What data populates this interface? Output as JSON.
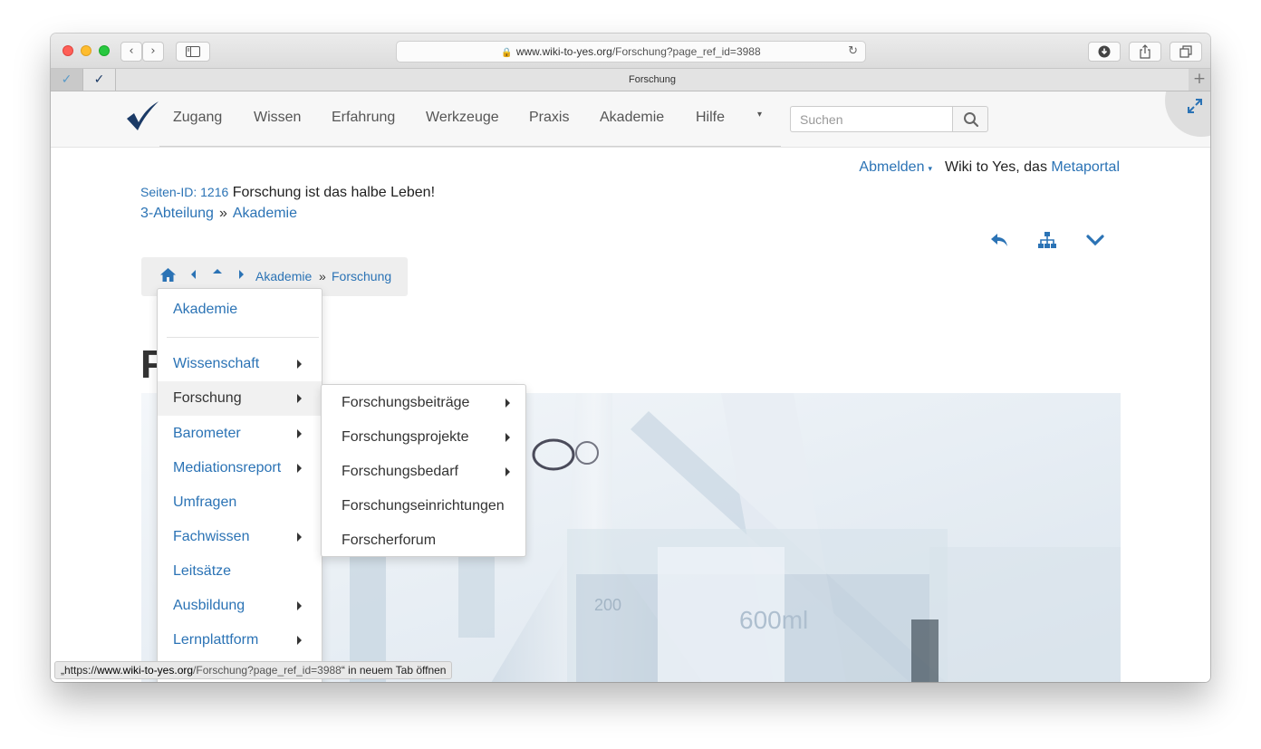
{
  "browser": {
    "url_host": "www.wiki-to-yes.org",
    "url_path": "/Forschung?page_ref_id=3988",
    "tab_title": "Forschung",
    "new_tab_label": "+",
    "back_icon": "‹",
    "forward_icon": "›"
  },
  "navbar": {
    "items": [
      "Zugang",
      "Wissen",
      "Erfahrung",
      "Werkzeuge",
      "Praxis",
      "Akademie",
      "Hilfe"
    ],
    "search_placeholder": "Suchen",
    "more_icon": "▾"
  },
  "user": {
    "logout_label": "Abmelden",
    "tagline": "Wiki to Yes, das",
    "portal_link": "Metaportal"
  },
  "page": {
    "id_label": "Seiten-ID: 1216",
    "title": "Forschung ist das halbe Leben!",
    "heading_letter": "F"
  },
  "crumbs": {
    "items": [
      "3-Abteilung",
      "Akademie"
    ],
    "separator": "»"
  },
  "breadcrumb_nav": {
    "items": [
      "Akademie",
      "Forschung"
    ],
    "separator": "»"
  },
  "menu": {
    "header": "Akademie",
    "items": [
      {
        "label": "Wissenschaft",
        "submenu": true
      },
      {
        "label": "Forschung",
        "submenu": true
      },
      {
        "label": "Barometer",
        "submenu": true
      },
      {
        "label": "Mediationsreport",
        "submenu": true
      },
      {
        "label": "Umfragen",
        "submenu": false
      },
      {
        "label": "Fachwissen",
        "submenu": true
      },
      {
        "label": "Leitsätze",
        "submenu": false
      },
      {
        "label": "Ausbildung",
        "submenu": true
      },
      {
        "label": "Lernplattform",
        "submenu": true
      }
    ]
  },
  "submenu": {
    "items": [
      {
        "label": "Forschungsbeiträge",
        "submenu": true
      },
      {
        "label": "Forschungsprojekte",
        "submenu": true
      },
      {
        "label": "Forschungsbedarf",
        "submenu": true
      },
      {
        "label": "Forschungseinrichtungen",
        "submenu": false
      },
      {
        "label": "Forscherforum",
        "submenu": false
      }
    ]
  },
  "status": {
    "prefix": "„https://",
    "host": "www.wiki-to-yes.org",
    "path": "/Forschung?page_ref_id=3988",
    "suffix": "“ in neuem Tab öffnen"
  },
  "icons": {
    "logo": "checkmark-logo-icon",
    "search": "search-icon",
    "reply": "reply-arrow-icon",
    "sitemap": "sitemap-icon",
    "expand": "chevron-down-icon",
    "home": "home-icon",
    "prev": "caret-left-icon",
    "up": "caret-up-icon",
    "next": "caret-right-icon",
    "fullscreen": "expand-arrows-icon"
  },
  "colors": {
    "link": "#2b73b5",
    "navy": "#1b3a66"
  }
}
